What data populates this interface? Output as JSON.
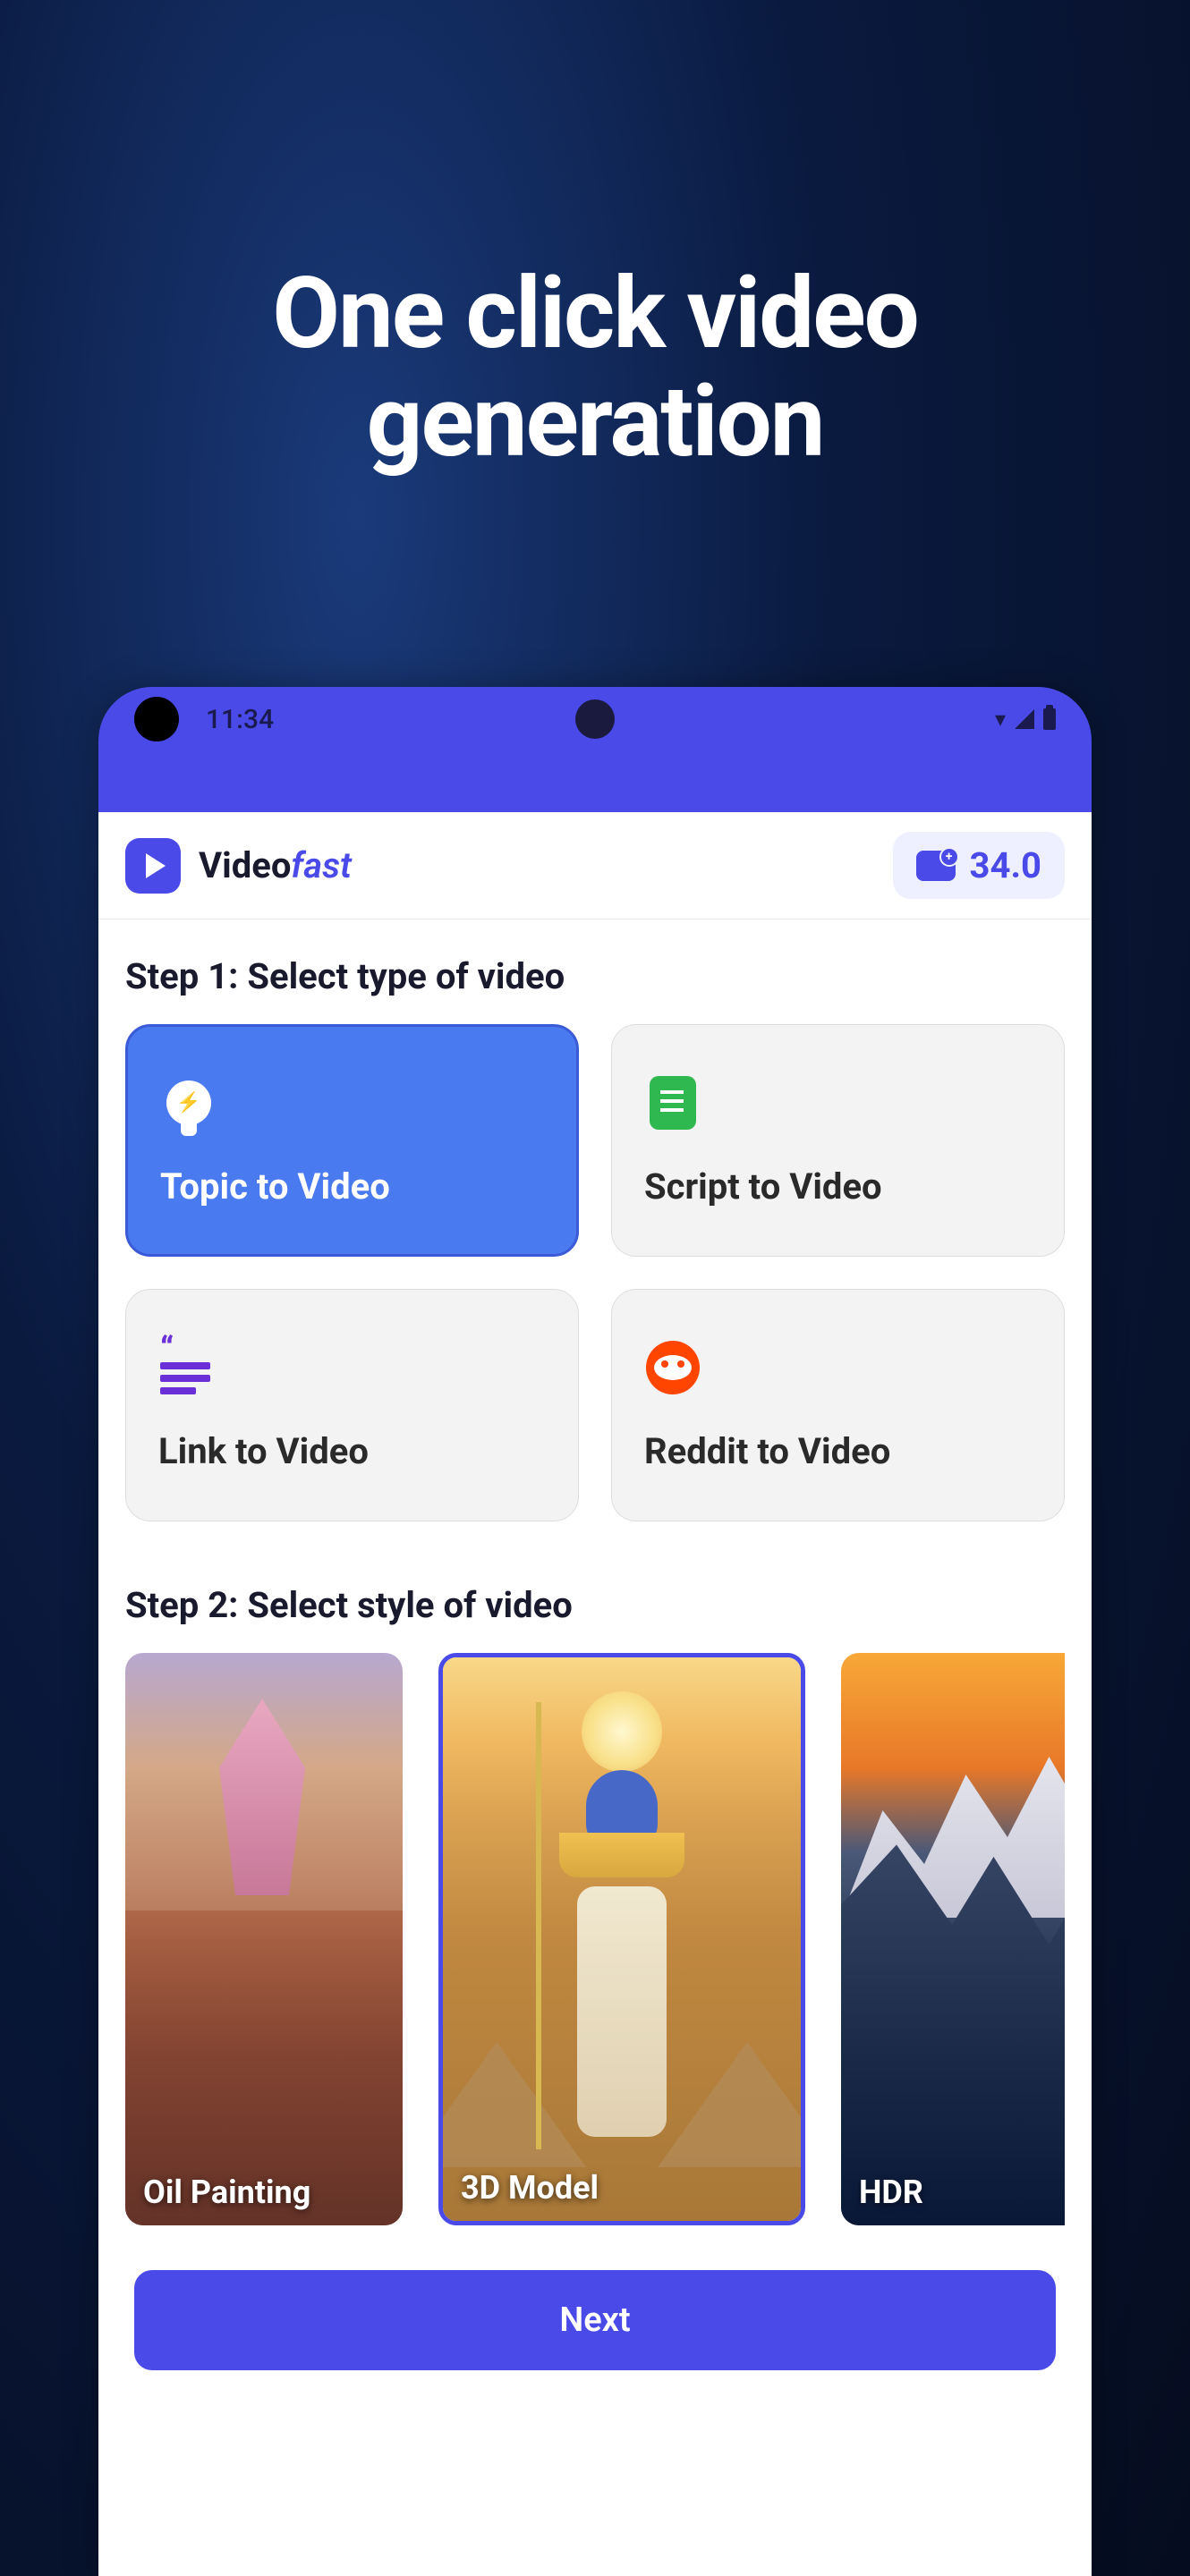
{
  "hero": {
    "title": "One click video generation"
  },
  "statusBar": {
    "time": "11:34"
  },
  "appHeader": {
    "brandPrefix": "Video",
    "brandSuffix": "fast",
    "credits": "34.0"
  },
  "step1": {
    "title": "Step 1: Select type of video",
    "types": [
      {
        "label": "Topic to Video",
        "selected": true
      },
      {
        "label": "Script to Video",
        "selected": false
      },
      {
        "label": "Link to Video",
        "selected": false
      },
      {
        "label": "Reddit to Video",
        "selected": false
      }
    ]
  },
  "step2": {
    "title": "Step 2: Select style of video",
    "styles": [
      {
        "label": "Oil Painting",
        "selected": false
      },
      {
        "label": "3D Model",
        "selected": true
      },
      {
        "label": "HDR",
        "selected": false
      }
    ]
  },
  "next": {
    "label": "Next"
  }
}
